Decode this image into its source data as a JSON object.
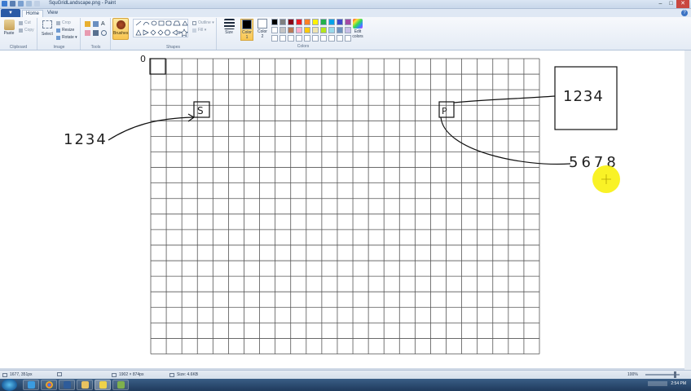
{
  "window": {
    "title": "SquGridLandscape.png - Paint",
    "controls": [
      "–",
      "□",
      "✕"
    ]
  },
  "tabs": {
    "file_label": "▼",
    "home": "Home",
    "view": "View"
  },
  "ribbon": {
    "clipboard": {
      "paste": "Paste",
      "cut": "Cut",
      "copy": "Copy",
      "label": "Clipboard"
    },
    "image": {
      "select": "Select",
      "crop": "Crop",
      "resize": "Resize",
      "rotate": "Rotate ▾",
      "label": "Image"
    },
    "tools": {
      "label": "Tools"
    },
    "brushes": "Brushes",
    "shapes": {
      "outline": "Outline ▾",
      "fill": "Fill ▾",
      "label": "Shapes"
    },
    "size": "Size",
    "color1": {
      "line1": "Color",
      "line2": "1"
    },
    "color2": {
      "line1": "Color",
      "line2": "2"
    },
    "colors_label": "Colors",
    "edit_colors": {
      "line1": "Edit",
      "line2": "colors"
    },
    "palette": [
      "#000000",
      "#7f7f7f",
      "#880015",
      "#ed1c24",
      "#ff7f27",
      "#fff200",
      "#22b14c",
      "#00a2e8",
      "#3f48cc",
      "#a349a4",
      "#ffffff",
      "#c3c3c3",
      "#b97a57",
      "#ffaec9",
      "#ffc90e",
      "#efe4b0",
      "#b5e61d",
      "#99d9ea",
      "#7092be",
      "#c8bfe7",
      "#ffffff",
      "#ffffff",
      "#ffffff",
      "#ffffff",
      "#ffffff",
      "#ffffff",
      "#ffffff",
      "#ffffff",
      "#ffffff",
      "#ffffff"
    ]
  },
  "canvas": {
    "label_zero": "0",
    "label_s": "S",
    "label_p": "P",
    "left_number": "1234",
    "box_number": "1234",
    "right_number": "5678"
  },
  "status": {
    "cursor": "1677, 351px",
    "image_size": "1902 × 874px",
    "file_size": "Size: 4.6KB",
    "zoom": "100%"
  },
  "taskbar": {
    "time": "2:54 PM"
  }
}
